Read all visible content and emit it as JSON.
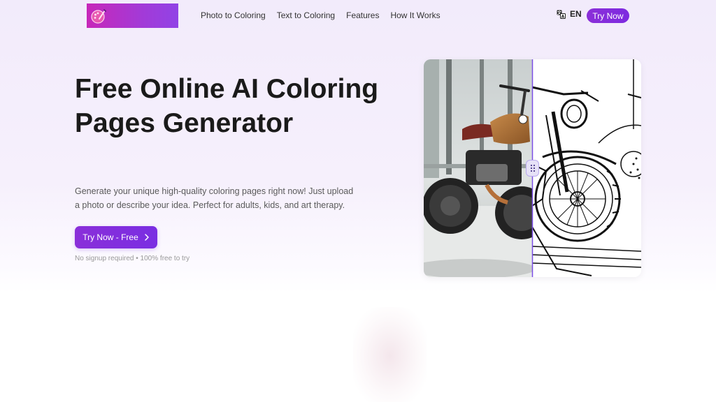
{
  "header": {
    "logo_icon": "palette-icon",
    "nav": [
      {
        "label": "Photo to Coloring"
      },
      {
        "label": "Text to Coloring"
      },
      {
        "label": "Features"
      },
      {
        "label": "How It Works"
      }
    ],
    "language_icon": "translate-icon",
    "language": "EN",
    "try_now": "Try Now"
  },
  "hero": {
    "title": "Free Online AI Coloring Pages Generator",
    "subtitle": "Generate your unique high-quality coloring pages right now! Just upload a photo or describe your idea. Perfect for adults, kids, and art therapy.",
    "cta_label": "Try Now - Free",
    "cta_icon": "chevron-right-icon",
    "note": "No signup required • 100% free to try"
  },
  "compare": {
    "handle_icon": "drag-dots-icon",
    "left_image": "motorcycle-photo",
    "right_image": "motorcycle-line-art",
    "slider_position": 0.5
  },
  "colors": {
    "accent": "#7d2ae0",
    "logo_gradient_start": "#c727b9",
    "logo_gradient_end": "#9143e6"
  }
}
